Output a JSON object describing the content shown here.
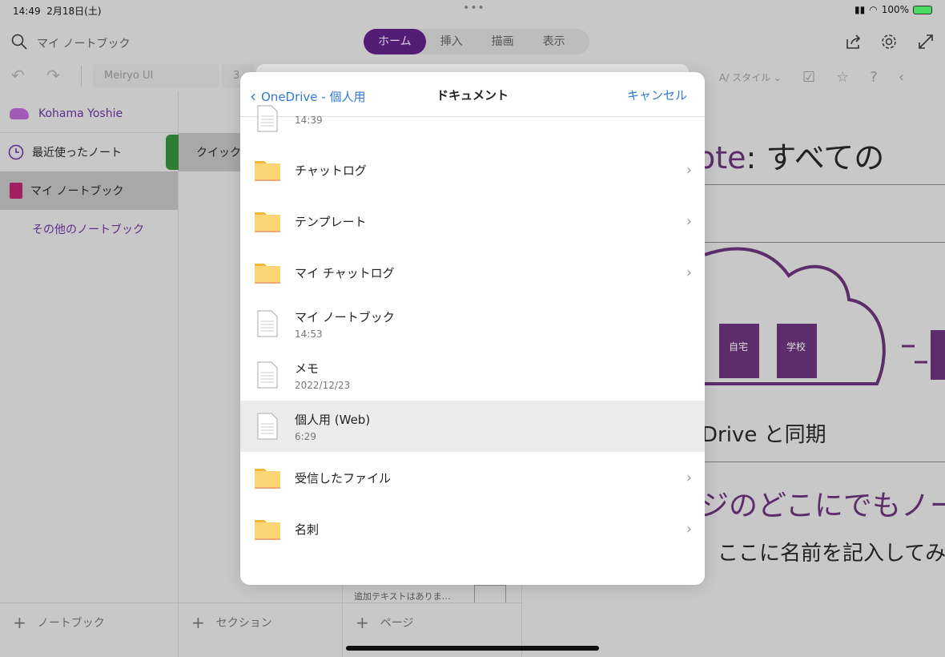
{
  "status": {
    "time": "14:49",
    "date": "2月18日(土)",
    "battery": "100%"
  },
  "topbar": {
    "title": "マイ ノートブック",
    "tabs": [
      {
        "label": "ホーム",
        "active": true
      },
      {
        "label": "挿入"
      },
      {
        "label": "描画"
      },
      {
        "label": "表示"
      }
    ]
  },
  "ribbon": {
    "font": "Meiryo UI",
    "size": "3",
    "style": "スタイル"
  },
  "sidebar": {
    "user": "Kohama Yoshie",
    "items": [
      {
        "label": "最近使ったノート"
      },
      {
        "label": "マイ ノートブック"
      },
      {
        "label": "その他のノートブック"
      }
    ],
    "add": "ノートブック"
  },
  "sections": {
    "items": [
      {
        "label": "クイック"
      }
    ],
    "add": "セクション",
    "color": "#2e7d32"
  },
  "pages": {
    "snippet": "追加テキストはありま…",
    "add": "ページ"
  },
  "content": {
    "title_accent": "ote",
    "title_rest": ": すべての",
    "nb1": "自宅",
    "nb2": "学校",
    "sync": "Drive と同期",
    "heading2": "ジのどこにでもノー",
    "line3": "、ここに名前を記入してみ",
    "accent": "#5d2d6b"
  },
  "dialog": {
    "back": "OneDrive - 個人用",
    "title": "ドキュメント",
    "cancel": "キャンセル",
    "items": [
      {
        "type": "file",
        "name": "",
        "sub": "14:39"
      },
      {
        "type": "folder",
        "name": "チャットログ"
      },
      {
        "type": "folder",
        "name": "テンプレート"
      },
      {
        "type": "folder",
        "name": "マイ チャットログ"
      },
      {
        "type": "file",
        "name": "マイ ノートブック",
        "sub": "14:53"
      },
      {
        "type": "file",
        "name": "メモ",
        "sub": "2022/12/23"
      },
      {
        "type": "file",
        "name": "個人用 (Web)",
        "sub": "6:29",
        "selected": true
      },
      {
        "type": "folder",
        "name": "受信したファイル"
      },
      {
        "type": "folder",
        "name": "名刺"
      }
    ]
  }
}
